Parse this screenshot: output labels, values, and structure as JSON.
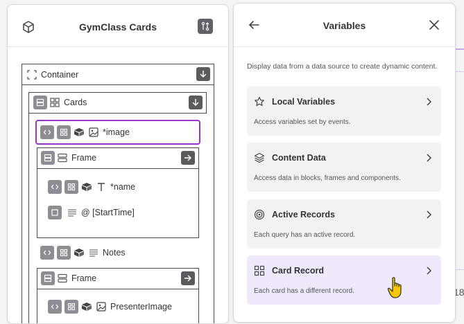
{
  "left_panel": {
    "title": "GymClass Cards",
    "tree": {
      "container": "Container",
      "cards": "Cards",
      "image": "*image",
      "frame1": "Frame",
      "name": "*name",
      "start_time": "@ [StartTime]",
      "notes": "Notes",
      "frame2": "Frame",
      "presenter_image": "PresenterImage"
    }
  },
  "right_panel": {
    "title": "Variables",
    "description": "Display data from a data source to create dynamic content.",
    "cards": [
      {
        "title": "Local Variables",
        "description": "Access variables set by events.",
        "icon": "star-icon"
      },
      {
        "title": "Content Data",
        "description": "Access data in blocks, frames and components.",
        "icon": "layers-icon"
      },
      {
        "title": "Active Records",
        "description": "Each query has an active record.",
        "icon": "target-icon"
      },
      {
        "title": "Card Record",
        "description": "Each card has a different record.",
        "icon": "grid-icon"
      }
    ]
  },
  "background": {
    "partial_text": "18"
  },
  "colors": {
    "accent_purple": "#9a36c9",
    "hover_card": "#efe9fb",
    "card_bg": "#f2f2f5",
    "dark_button": "#5a5a5f",
    "gray_button": "#8d8d93"
  }
}
